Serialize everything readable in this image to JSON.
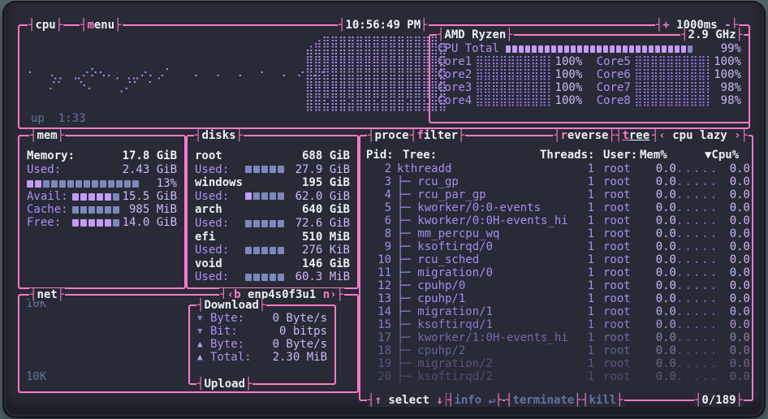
{
  "titlebar": {
    "cpu_tab": {
      "label": "cpu"
    },
    "menu_tab": {
      "key": "m",
      "rest": "enu"
    },
    "clock": "10:56:49 PM",
    "interval": {
      "plus": "+",
      "value": "1000ms",
      "minus": "-"
    }
  },
  "cpu": {
    "model": "AMD Ryzen",
    "frequency": "2.9 GHz",
    "uptime_label": "up",
    "uptime_value": "1:33",
    "total": {
      "label": "CPU Total",
      "percent": "99%",
      "bar_pattern": "ppppppppppppppppppppppppppppb"
    },
    "meter_glyphs": "⣿⣿⣿⣿⣿⣿⣿⣿⣿⣿⣿",
    "cores": [
      {
        "name": "Core1",
        "percent": "100%"
      },
      {
        "name": "Core2",
        "percent": "100%"
      },
      {
        "name": "Core3",
        "percent": "100%"
      },
      {
        "name": "Core4",
        "percent": "100%"
      },
      {
        "name": "Core5",
        "percent": "100%"
      },
      {
        "name": "Core6",
        "percent": "100%"
      },
      {
        "name": "Core7",
        "percent": "98%"
      },
      {
        "name": "Core8",
        "percent": "98%"
      }
    ],
    "graph_sparse": [
      "⠂  ⢄⡀ ⣀⠔⠕⠢⠄⡀⢀⣀⠔⠄⡠⠁   ⠄  ⠄  ⠄  ⠂  ⠄ ⠔ ⠄⠂",
      "   ⠌⠁  ⠑⠄   ⢀⠌⠁ ⠁"
    ],
    "graph_dense": [
      "⢀⣴⣿⣿⣿⣿⣿⣿⣿⣿⣿⣿⣿⣿⣿⣿⣿",
      "⣿⣿⣿⣿⣿⣿⣿⣿⣿⣿⣿⣿⣿⣿⣿⣿⣿",
      "⣿⣿⣿⣿⣿⣿⣿⣿⣿⣿⣿⣿⣿⣿⣿⣿⣿",
      "⣿⣿⣿⣿⣿⣿⣿⣿⣿⣿⣿⣿⣿⣿⣿⣿⣿",
      "⣿⣿⣿⣿⣿⣿⣿⣿⣿⣿⣿⣿⣿⣿⣿⣿⣿",
      "⣿⣿⣷⣿⣿⣾⣿⣿⣷⣿⣿⣿⣾⣿⣷⣿⣿"
    ]
  },
  "mem": {
    "title": "mem",
    "memory_label": "Memory:",
    "memory_value": "17.8 GiB",
    "used_label": "Used:",
    "used_value": "2.43 GiB",
    "used_bar": {
      "pattern": "ppbbbbbbbbbbbb",
      "percent": "13%"
    },
    "stats": [
      {
        "label": "Avail:",
        "bar": "pppppb",
        "value": "15.5 GiB"
      },
      {
        "label": "Cache:",
        "bar": "bbbbbb",
        "value": "985 MiB"
      },
      {
        "label": "Free:",
        "bar": "pppppb",
        "value": "14.0 GiB"
      }
    ]
  },
  "disks": {
    "title": "disks",
    "entries": [
      {
        "name": "root",
        "size": "688 GiB",
        "used_label": "Used:",
        "used": "27.9 GiB",
        "bar": "bbbbb"
      },
      {
        "name": "windows",
        "size": "195 GiB",
        "used_label": "Used:",
        "used": "62.0 GiB",
        "bar": "pbbbb"
      },
      {
        "name": "arch",
        "size": "640 GiB",
        "used_label": "Used:",
        "used": "72.6 GiB",
        "bar": "bbbbb"
      },
      {
        "name": "efi",
        "size": "510 MiB",
        "used_label": "Used:",
        "used": "276 KiB",
        "bar": "bbbbb"
      },
      {
        "name": "void",
        "size": "146 GiB",
        "used_label": "Used:",
        "used": "60.3 MiB",
        "bar": "bbbbb"
      }
    ]
  },
  "net": {
    "title": "net",
    "prev_key": "‹b",
    "iface": "enp4s0f3u1",
    "next_key": "n›",
    "scale_top": "10K",
    "scale_bottom": "10K",
    "download_title": "Download",
    "upload_title": "Upload",
    "rows": [
      {
        "arrow": "▼",
        "dir": "down",
        "label": "Byte:",
        "value": "0 Byte/s"
      },
      {
        "arrow": "▼",
        "dir": "down",
        "label": "Bit:",
        "value": "0 bitps"
      },
      {
        "arrow": "▲",
        "dir": "up",
        "label": "Byte:",
        "value": "0 Byte/s"
      },
      {
        "arrow": "▲",
        "dir": "up",
        "label": "Total:",
        "value": "2.30 MiB"
      }
    ]
  },
  "processes": {
    "title": "processes",
    "filter": {
      "key": "f",
      "rest": "ilter"
    },
    "reverse": {
      "key": "r",
      "rest": "everse"
    },
    "tree": {
      "key": "t",
      "rest": "ree"
    },
    "sort": {
      "prev": "‹",
      "label": "cpu lazy",
      "next": "›"
    },
    "header": {
      "pid": "Pid:",
      "tree": "Tree:",
      "threads": "Threads:",
      "user": "User:",
      "mem": "Mem%",
      "cpu": "▼Cpu%"
    },
    "footer": {
      "up_arrow": "↑",
      "select": "select",
      "down_arrow": "↓",
      "info": "info",
      "enter": "↵",
      "terminate": "terminate",
      "kill": "kill",
      "counter": "0/189"
    },
    "idle_graph": ".....",
    "tree_branch": "├─ ",
    "rows": [
      {
        "pid": "2",
        "name": "kthreadd",
        "child": false,
        "threads": "1",
        "user": "root",
        "mem": "0.0",
        "cpu": "0.0"
      },
      {
        "pid": "3",
        "name": "rcu_gp",
        "child": true,
        "threads": "1",
        "user": "root",
        "mem": "0.0",
        "cpu": "0.0"
      },
      {
        "pid": "4",
        "name": "rcu_par_gp",
        "child": true,
        "threads": "1",
        "user": "root",
        "mem": "0.0",
        "cpu": "0.0"
      },
      {
        "pid": "5",
        "name": "kworker/0:0-events",
        "child": true,
        "threads": "1",
        "user": "root",
        "mem": "0.0",
        "cpu": "0.0"
      },
      {
        "pid": "6",
        "name": "kworker/0:0H-events_hi",
        "child": true,
        "threads": "1",
        "user": "root",
        "mem": "0.0",
        "cpu": "0.0"
      },
      {
        "pid": "8",
        "name": "mm_percpu_wq",
        "child": true,
        "threads": "1",
        "user": "root",
        "mem": "0.0",
        "cpu": "0.0"
      },
      {
        "pid": "9",
        "name": "ksoftirqd/0",
        "child": true,
        "threads": "1",
        "user": "root",
        "mem": "0.0",
        "cpu": "0.0"
      },
      {
        "pid": "10",
        "name": "rcu_sched",
        "child": true,
        "threads": "1",
        "user": "root",
        "mem": "0.0",
        "cpu": "0.0"
      },
      {
        "pid": "11",
        "name": "migration/0",
        "child": true,
        "threads": "1",
        "user": "root",
        "mem": "0.0",
        "cpu": "0.0"
      },
      {
        "pid": "12",
        "name": "cpuhp/0",
        "child": true,
        "threads": "1",
        "user": "root",
        "mem": "0.0",
        "cpu": "0.0"
      },
      {
        "pid": "13",
        "name": "cpuhp/1",
        "child": true,
        "threads": "1",
        "user": "root",
        "mem": "0.0",
        "cpu": "0.0"
      },
      {
        "pid": "14",
        "name": "migration/1",
        "child": true,
        "threads": "1",
        "user": "root",
        "mem": "0.0",
        "cpu": "0.0"
      },
      {
        "pid": "15",
        "name": "ksoftirqd/1",
        "child": true,
        "threads": "1",
        "user": "root",
        "mem": "0.0",
        "cpu": "0.0"
      },
      {
        "pid": "17",
        "name": "kworker/1:0H-events_hi",
        "child": true,
        "threads": "1",
        "user": "root",
        "mem": "0.0",
        "cpu": "0.0"
      },
      {
        "pid": "18",
        "name": "cpuhp/2",
        "child": true,
        "threads": "1",
        "user": "root",
        "mem": "0.0",
        "cpu": "0.0"
      },
      {
        "pid": "19",
        "name": "migration/2",
        "child": true,
        "threads": "1",
        "user": "root",
        "mem": "0.0",
        "cpu": "0.0"
      },
      {
        "pid": "20",
        "name": "ksoftirqd/2",
        "child": true,
        "threads": "1",
        "user": "root",
        "mem": "0.0",
        "cpu": "0.0"
      }
    ]
  },
  "colors": {
    "background": "#282a36",
    "border_pink": "#ff79c6",
    "purple_text": "#b18ff5",
    "lavender_value": "#cfb8fb",
    "dim_blue": "#6272a4",
    "meter_purple": "#c49bf8",
    "meter_blue": "#7c89bd",
    "white": "#eef0f5"
  }
}
